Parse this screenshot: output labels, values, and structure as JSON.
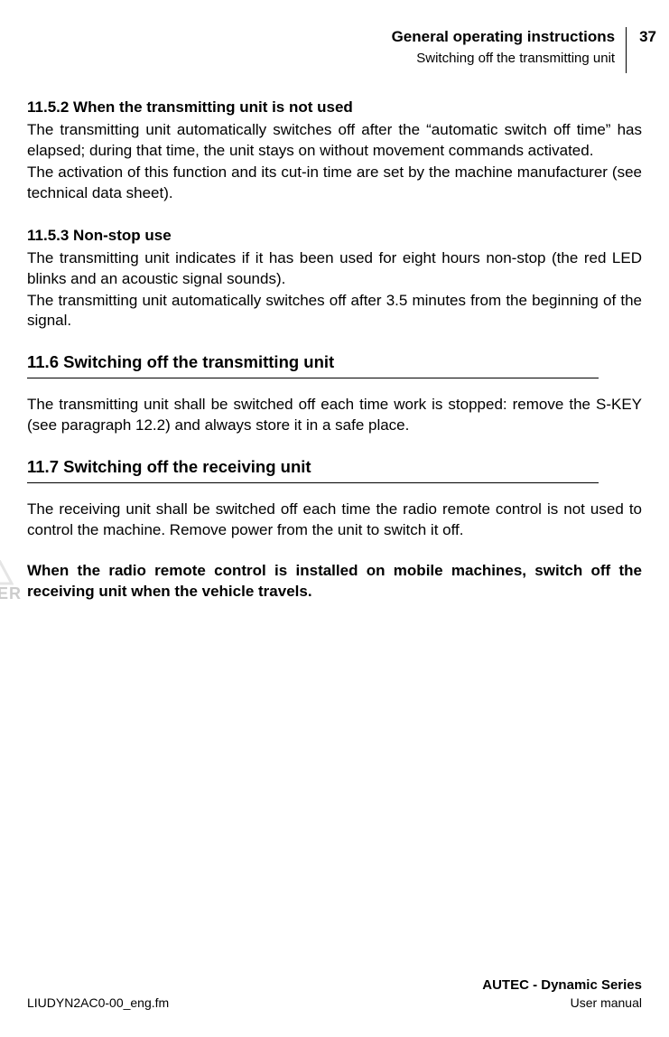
{
  "header": {
    "title": "General operating instructions",
    "subtitle": "Switching off the transmitting unit",
    "page": "37"
  },
  "sections": {
    "s1152": {
      "heading": "11.5.2 When the transmitting unit is not used",
      "p1": "The transmitting unit automatically switches off after the “automatic switch off time” has elapsed; during that time, the unit stays on without movement commands activated.",
      "p2": "The activation of this function and its cut-in time are set by the machine manufacturer (see technical data sheet)."
    },
    "s1153": {
      "heading": "11.5.3 Non-stop use",
      "p1": "The transmitting unit indicates if it has been used for eight hours non-stop (the red LED blinks and an acoustic signal sounds).",
      "p2": "The transmitting unit automatically switches off after 3.5 minutes from the beginning of the signal."
    },
    "s116": {
      "heading": "11.6 Switching off the transmitting unit",
      "p1": "The transmitting unit shall be switched off each time work is stopped: remove the S-KEY (see paragraph 12.2) and always store it in a safe place."
    },
    "s117": {
      "heading": "11.7 Switching off the receiving unit",
      "p1": "The receiving unit shall be switched off each time the radio remote control is not used to control the machine. Remove power from the unit to switch it off.",
      "p2": "When the radio remote control is installed on mobile machines, switch off the receiving unit when the vehicle travels."
    }
  },
  "footer": {
    "left": "LIUDYN2AC0-00_eng.fm",
    "brand": "AUTEC - Dynamic Series",
    "doc": "User manual"
  },
  "watermark": "GER"
}
